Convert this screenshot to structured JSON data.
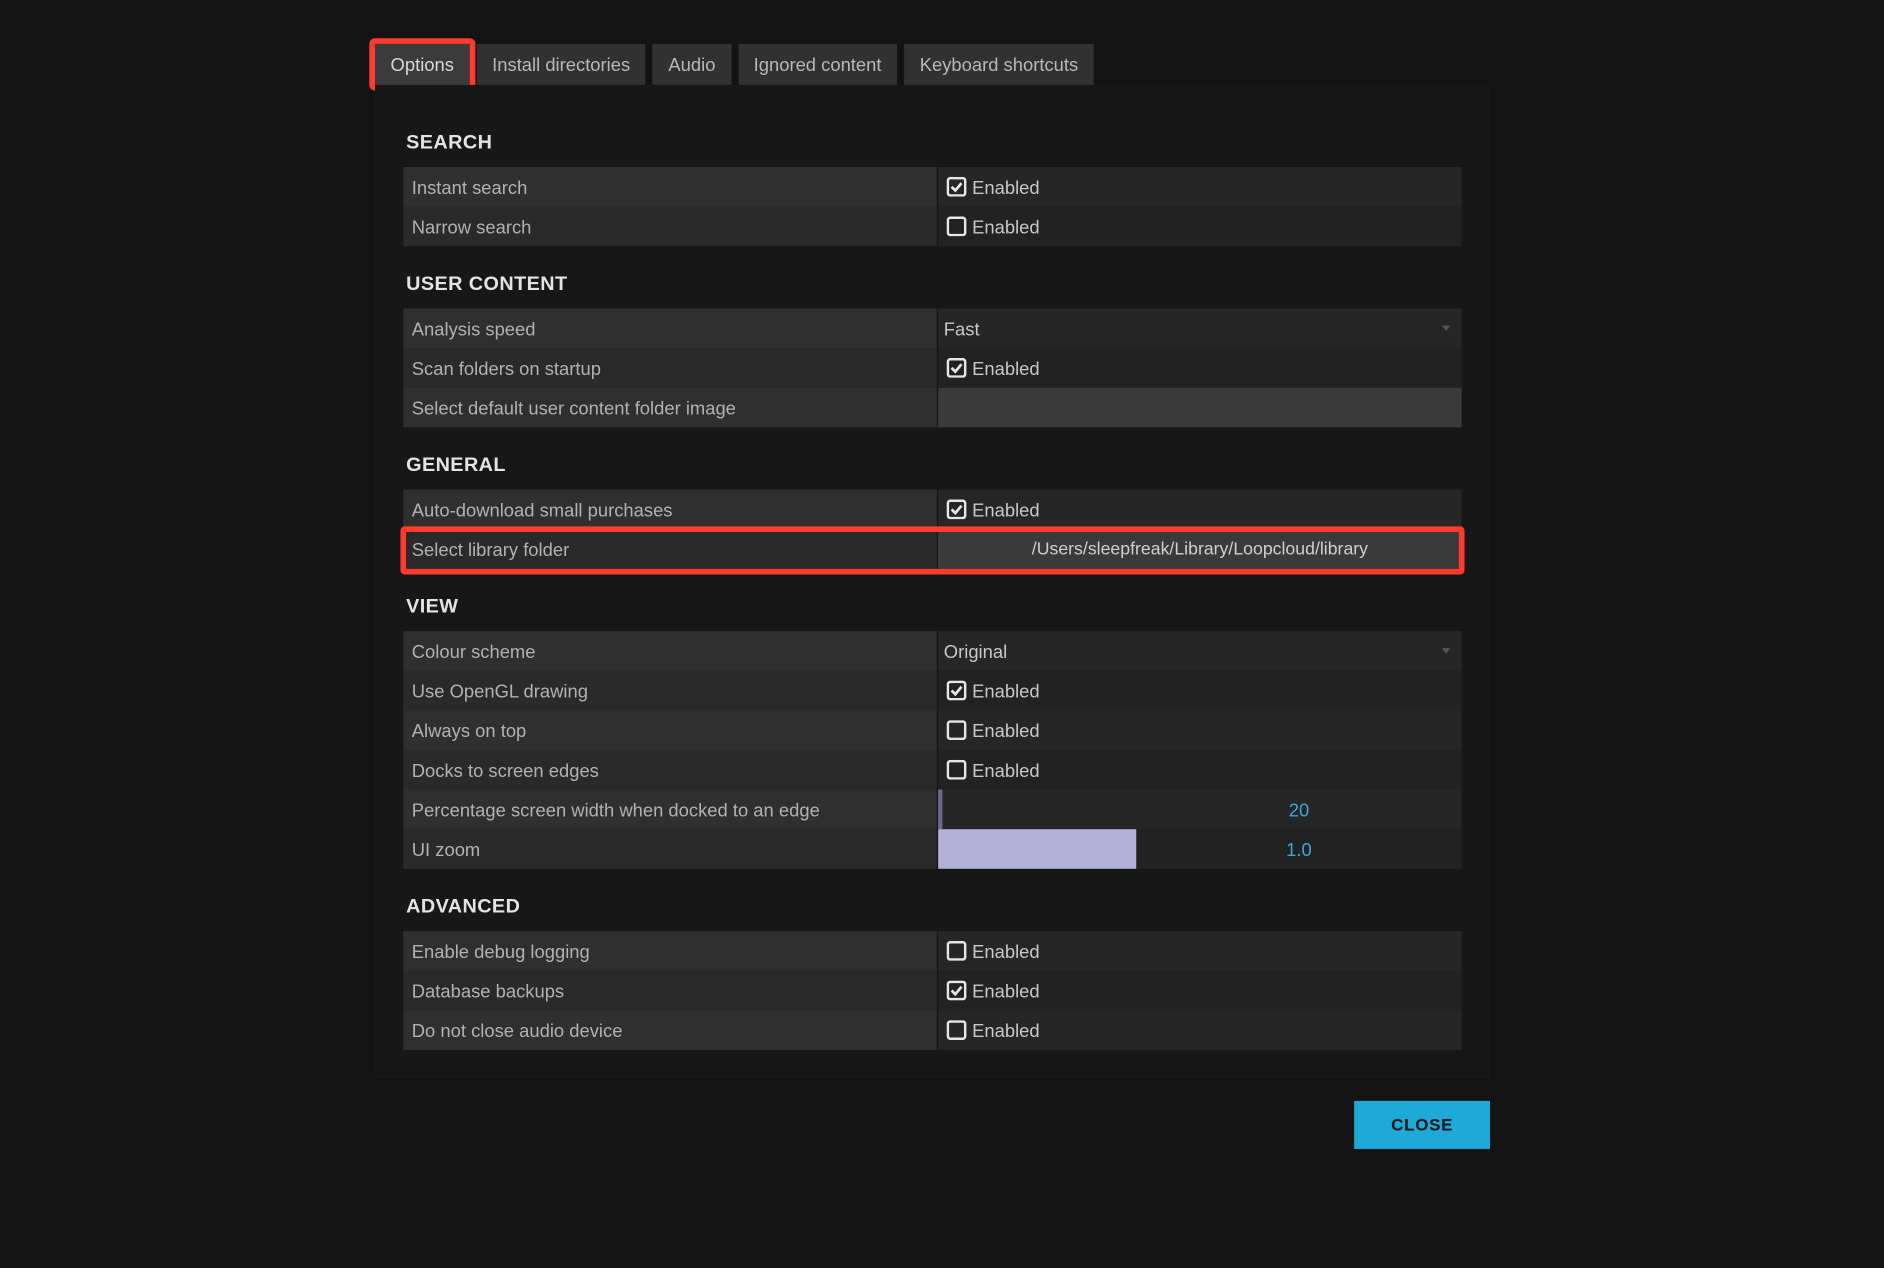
{
  "tabs": [
    "Options",
    "Install directories",
    "Audio",
    "Ignored content",
    "Keyboard shortcuts"
  ],
  "active_tab": 0,
  "enabled_label": "Enabled",
  "sections": {
    "search": {
      "title": "SEARCH",
      "rows": {
        "instant": {
          "label": "Instant search",
          "checked": true
        },
        "narrow": {
          "label": "Narrow search",
          "checked": false
        }
      }
    },
    "user_content": {
      "title": "USER CONTENT",
      "rows": {
        "analysis_speed": {
          "label": "Analysis speed",
          "value": "Fast"
        },
        "scan_startup": {
          "label": "Scan folders on startup",
          "checked": true
        },
        "default_image": {
          "label": "Select default user content folder image",
          "value": ""
        }
      }
    },
    "general": {
      "title": "GENERAL",
      "rows": {
        "auto_download": {
          "label": "Auto-download small purchases",
          "checked": true
        },
        "library_folder": {
          "label": "Select library folder",
          "value": "/Users/sleepfreak/Library/Loopcloud/library"
        }
      }
    },
    "view": {
      "title": "VIEW",
      "rows": {
        "colour_scheme": {
          "label": "Colour scheme",
          "value": "Original"
        },
        "opengl": {
          "label": "Use OpenGL drawing",
          "checked": true
        },
        "always_top": {
          "label": "Always on top",
          "checked": false
        },
        "docks_edges": {
          "label": "Docks to screen edges",
          "checked": false
        },
        "docked_width": {
          "label": "Percentage screen width when docked to an edge",
          "value": "20"
        },
        "ui_zoom": {
          "label": "UI zoom",
          "value": "1.0"
        }
      }
    },
    "advanced": {
      "title": "ADVANCED",
      "rows": {
        "debug_log": {
          "label": "Enable debug logging",
          "checked": false
        },
        "db_backups": {
          "label": "Database backups",
          "checked": true
        },
        "no_close_audio": {
          "label": "Do not close audio device",
          "checked": false
        }
      }
    }
  },
  "close_label": "CLOSE"
}
